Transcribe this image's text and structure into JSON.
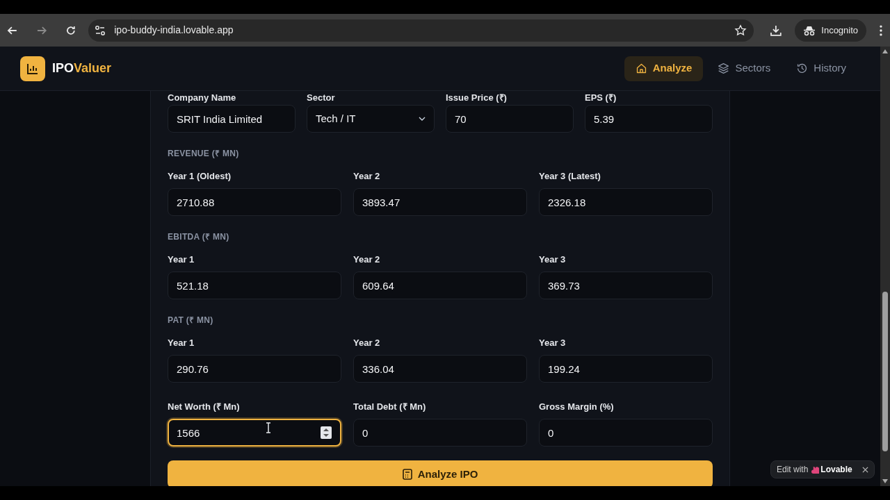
{
  "browser": {
    "url": "ipo-buddy-india.lovable.app",
    "profile": "Incognito"
  },
  "header": {
    "logo_prefix": "IPO",
    "logo_suffix": "Valuer",
    "nav": [
      {
        "label": "Analyze",
        "selected": true
      },
      {
        "label": "Sectors",
        "selected": false
      },
      {
        "label": "History",
        "selected": false
      }
    ]
  },
  "top_fields": [
    {
      "label": "Company Name",
      "value": "SRIT India Limited",
      "kind": "text"
    },
    {
      "label": "Sector",
      "value": "Tech / IT",
      "kind": "select"
    },
    {
      "label": "Issue Price (₹)",
      "value": "70",
      "kind": "text"
    },
    {
      "label": "EPS (₹)",
      "value": "5.39",
      "kind": "text"
    }
  ],
  "sections": [
    {
      "title": "REVENUE (₹ MN)",
      "fields": [
        {
          "label": "Year 1 (Oldest)",
          "value": "2710.88"
        },
        {
          "label": "Year 2",
          "value": "3893.47"
        },
        {
          "label": "Year 3 (Latest)",
          "value": "2326.18"
        }
      ]
    },
    {
      "title": "EBITDA (₹ MN)",
      "fields": [
        {
          "label": "Year 1",
          "value": "521.18"
        },
        {
          "label": "Year 2",
          "value": "609.64"
        },
        {
          "label": "Year 3",
          "value": "369.73"
        }
      ]
    },
    {
      "title": "PAT (₹ MN)",
      "fields": [
        {
          "label": "Year 1",
          "value": "290.76"
        },
        {
          "label": "Year 2",
          "value": "336.04"
        },
        {
          "label": "Year 3",
          "value": "199.24"
        }
      ]
    }
  ],
  "bottom_fields": [
    {
      "label": "Net Worth (₹ Mn)",
      "value": "1566",
      "focused": true
    },
    {
      "label": "Total Debt (₹ Mn)",
      "value": "0",
      "focused": false
    },
    {
      "label": "Gross Margin (%)",
      "value": "0",
      "focused": false
    }
  ],
  "submit_button": "Analyze IPO",
  "badge": {
    "prefix": "Edit with",
    "brand": "Lovable"
  }
}
